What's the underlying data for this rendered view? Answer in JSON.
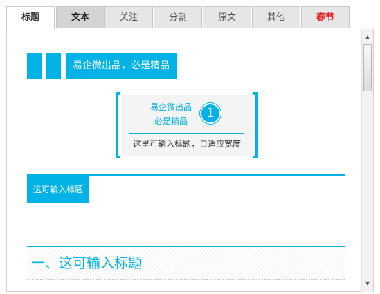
{
  "tabs": [
    {
      "label": "标题"
    },
    {
      "label": "文本"
    },
    {
      "label": "关注"
    },
    {
      "label": "分割"
    },
    {
      "label": "原文"
    },
    {
      "label": "其他"
    },
    {
      "label": "春节"
    }
  ],
  "active_tab": "标题",
  "colors": {
    "accent": "#00b2e5",
    "festival_tab": "#e02020"
  },
  "blocks": {
    "title1": {
      "text": "易企微出品，必是精品"
    },
    "title2": {
      "line1": "易企微出品",
      "line2": "必是精品",
      "number": "1",
      "subtitle": "这里可输入标题，自适应宽度"
    },
    "title3": {
      "text": "这可输入标题"
    },
    "title4": {
      "text": "一、这可输入标题"
    }
  },
  "scrollbar": {
    "up_icon": "arrow-up-icon",
    "down_icon": "arrow-down-icon"
  }
}
